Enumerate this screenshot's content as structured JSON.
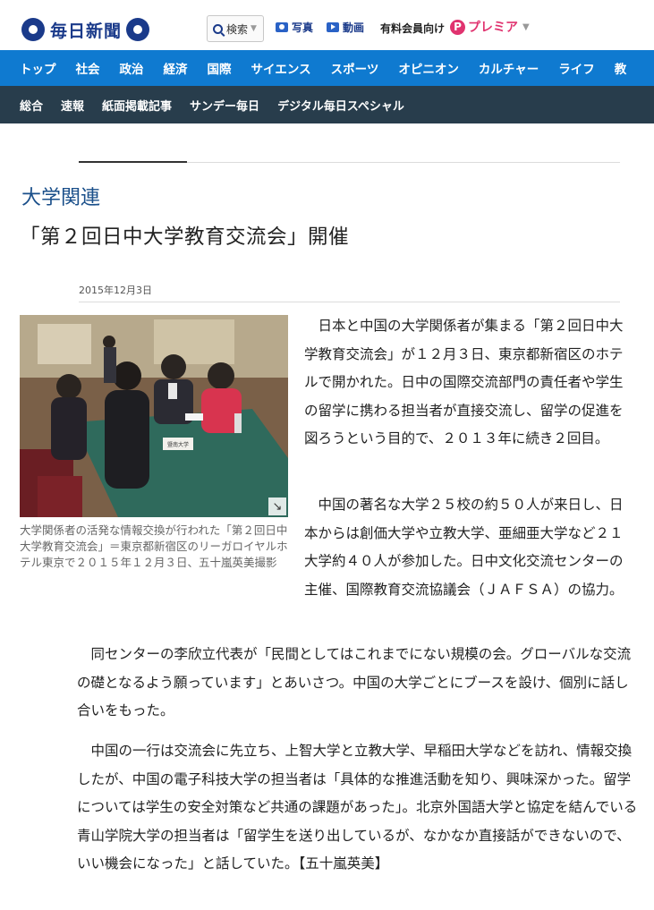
{
  "header": {
    "logo_text": "毎日新聞",
    "search_label": "検索",
    "photo_label": "写真",
    "video_label": "動画",
    "paid_label": "有料会員向け",
    "premier_icon": "P",
    "premier_label": "プレミア"
  },
  "main_nav": [
    "トップ",
    "社会",
    "政治",
    "経済",
    "国際",
    "サイエンス",
    "スポーツ",
    "オピニオン",
    "カルチャー",
    "ライフ",
    "教"
  ],
  "sub_nav": [
    "総合",
    "速報",
    "紙面掲載記事",
    "サンデー毎日",
    "デジタル毎日スペシャル"
  ],
  "article": {
    "category": "大学関連",
    "headline": "「第２回日中大学教育交流会」開催",
    "date": "2015年12月3日",
    "photo_caption": "大学関係者の活発な情報交換が行われた「第２回日中大学教育交流会」＝東京都新宿区のリーガロイヤルホテル東京で２０１５年１２月３日、五十嵐英美撮影",
    "photo_sign": "暨南大学",
    "paragraphs": [
      "日本と中国の大学関係者が集まる「第２回日中大学教育交流会」が１２月３日、東京都新宿区のホテルで開かれた。日中の国際交流部門の責任者や学生の留学に携わる担当者が直接交流し、留学の促進を図ろうという目的で、２０１３年に続き２回目。",
      "中国の著名な大学２５校の約５０人が来日し、日本からは創価大学や立教大学、亜細亜大学など２１大学約４０人が参加した。日中文化交流センターの主催、国際教育交流協議会（ＪＡＦＳＡ）の協力。",
      "同センターの李欣立代表が「民間としてはこれまでにない規模の会。グローバルな交流の礎となるよう願っています」とあいさつ。中国の大学ごとにブースを設け、個別に話し合いをもった。",
      "中国の一行は交流会に先立ち、上智大学と立教大学、早稲田大学などを訪れ、情報交換したが、中国の電子科技大学の担当者は「具体的な推進活動を知り、興味深かった。留学については学生の安全対策など共通の課題があった」。北京外国語大学と協定を結んでいる青山学院大学の担当者は「留学生を送り出しているが、なかなか直接話ができないので、いい機会になった」と話していた。【五十嵐英美】"
    ]
  },
  "colors": {
    "brand": "#1a3a8a",
    "main_nav_bg": "#0f7ad0",
    "sub_nav_bg": "#283d4c",
    "premier": "#e0336f",
    "category": "#1a4f8a"
  },
  "icons": [
    "logo-mark-icon",
    "search-icon",
    "camera-icon",
    "video-play-icon",
    "premier-p-icon",
    "expand-icon"
  ]
}
